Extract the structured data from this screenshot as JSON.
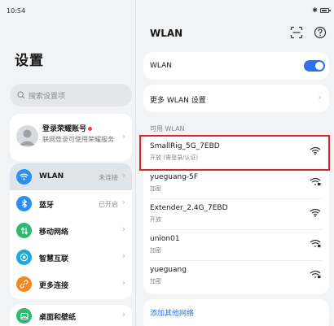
{
  "status_bar": {
    "time": "10:54",
    "battery_level": 0.8
  },
  "left": {
    "title": "设置",
    "search_placeholder": "搜索设置项",
    "account": {
      "title": "登录荣耀账号",
      "description": "联网登录可使用荣耀服务"
    },
    "menu": [
      {
        "label": "WLAN",
        "status": "未连接",
        "icon": "wifi-icon",
        "color": "#2a8ff0",
        "active": true
      },
      {
        "label": "蓝牙",
        "status": "已开启",
        "icon": "bluetooth-icon",
        "color": "#2a8ff0",
        "active": false
      },
      {
        "label": "移动网络",
        "status": "",
        "icon": "mobile-network-icon",
        "color": "#2eb872",
        "active": false
      },
      {
        "label": "智慧互联",
        "status": "",
        "icon": "smart-connect-icon",
        "color": "#1fa8d8",
        "active": false
      },
      {
        "label": "更多连接",
        "status": "",
        "icon": "more-connections-icon",
        "color": "#f08a1c",
        "active": false
      }
    ],
    "desktop_label": "桌面和壁纸"
  },
  "right": {
    "title": "WLAN",
    "wlan_toggle_label": "WLAN",
    "wlan_enabled": true,
    "more_settings": "更多 WLAN 设置",
    "available_header": "可用 WLAN",
    "networks": [
      {
        "name": "SmallRig_5G_7EBD",
        "security": "开放 (需登录/认证)",
        "icon": "wifi-open-icon",
        "highlighted": true
      },
      {
        "name": "yueguang-5F",
        "security": "加密",
        "icon": "wifi-locked-icon"
      },
      {
        "name": "Extender_2.4G_7EBD",
        "security": "开放",
        "icon": "wifi-open-icon"
      },
      {
        "name": "union01",
        "security": "加密",
        "icon": "wifi-locked-icon"
      },
      {
        "name": "yueguang",
        "security": "加密",
        "icon": "wifi-locked-icon"
      }
    ],
    "add_network": "添加其他网络"
  },
  "colors": {
    "accent": "#2f72e8",
    "highlight": "#d9262c",
    "background": "#f1f3f5"
  }
}
